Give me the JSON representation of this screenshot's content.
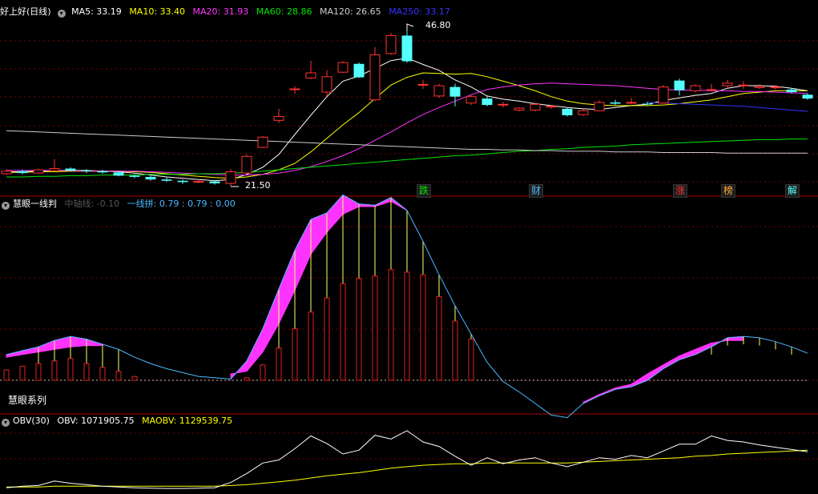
{
  "colors": {
    "up": "#ff3232",
    "down": "#54ffff",
    "ma5": "#ffffff",
    "ma10": "#ffff00",
    "ma20": "#ff33ff",
    "ma60": "#00e600",
    "ma120": "#cccccc",
    "ma250": "#3333ff",
    "grid": "#7a0000",
    "fill": "#ff33ff",
    "line2": "#4db8ff",
    "obv": "#ffffff",
    "maobv": "#ffff00"
  },
  "main_header": {
    "title": "好上好(日线)",
    "ma5": "MA5: 33.19",
    "ma10": "MA10: 33.40",
    "ma20": "MA20: 31.93",
    "ma60": "MA60: 28.86",
    "ma120": "MA120: 26.65",
    "ma250": "MA250: 33.17"
  },
  "sub1_header": {
    "title": "慧眼一线判",
    "item1": "中轴线: -0.10",
    "item2": "一线拼: 0.79 : 0.79 : 0.00"
  },
  "sub1_label": "慧眼系列",
  "sub2_header": {
    "title": "OBV(30)",
    "obv": "OBV: 1071905.75",
    "maobv": "MAOBV: 1129539.75"
  },
  "annotations": {
    "high": "46.80",
    "low": "21.50"
  },
  "tags": [
    {
      "text": "跌",
      "color": "#00e600",
      "idx": 26
    },
    {
      "text": "财",
      "color": "#4db8ff",
      "idx": 33
    },
    {
      "text": "涨",
      "color": "#ff3232",
      "idx": 42
    },
    {
      "text": "榜",
      "color": "#ffaa33",
      "idx": 45
    },
    {
      "text": "解",
      "color": "#54ffff",
      "idx": 49
    }
  ],
  "chart_data": [
    {
      "type": "candlestick",
      "title": "好上好(日线)",
      "ylim": [
        20,
        48
      ],
      "candles": [
        [
          23.5,
          23.9,
          24.2,
          23.3
        ],
        [
          23.9,
          23.6,
          24.1,
          23.4
        ],
        [
          23.6,
          24.1,
          24.3,
          23.5
        ],
        [
          24.0,
          24.3,
          25.8,
          23.9
        ],
        [
          24.3,
          24.0,
          24.5,
          23.8
        ],
        [
          24.0,
          23.9,
          24.2,
          23.6
        ],
        [
          23.9,
          23.7,
          24.1,
          23.5
        ],
        [
          23.7,
          23.2,
          23.9,
          23.1
        ],
        [
          23.2,
          23.0,
          23.4,
          22.8
        ],
        [
          23.0,
          22.6,
          23.2,
          22.4
        ],
        [
          22.6,
          22.4,
          22.9,
          22.2
        ],
        [
          22.4,
          22.2,
          22.6,
          21.9
        ],
        [
          22.2,
          22.3,
          22.6,
          22.0
        ],
        [
          22.3,
          22.0,
          22.5,
          21.8
        ],
        [
          22.0,
          23.8,
          24.2,
          21.5
        ],
        [
          23.6,
          26.2,
          26.5,
          23.5
        ],
        [
          27.6,
          29.2,
          29.4,
          27.5
        ],
        [
          31.8,
          32.4,
          33.6,
          31.4
        ],
        [
          36.7,
          36.7,
          37.1,
          35.9
        ],
        [
          38.4,
          39.2,
          41.1,
          38.2
        ],
        [
          36.2,
          38.6,
          39.6,
          35.6
        ],
        [
          39.3,
          40.8,
          41.0,
          39.2
        ],
        [
          40.6,
          38.5,
          40.8,
          38.4
        ],
        [
          35.0,
          42.0,
          43.2,
          34.8
        ],
        [
          42.2,
          45.0,
          45.4,
          42.0
        ],
        [
          45.0,
          41.0,
          46.8,
          40.8
        ],
        [
          37.4,
          37.4,
          38.1,
          36.7
        ],
        [
          35.6,
          37.2,
          37.5,
          35.3
        ],
        [
          37.0,
          35.5,
          37.5,
          34.0
        ],
        [
          34.5,
          35.5,
          35.8,
          34.2
        ],
        [
          35.2,
          34.2,
          35.6,
          34.0
        ],
        [
          34.3,
          34.3,
          34.7,
          33.8
        ],
        [
          33.4,
          33.7,
          33.9,
          33.2
        ],
        [
          33.4,
          34.3,
          34.5,
          33.2
        ],
        [
          34.0,
          34.0,
          34.2,
          33.6
        ],
        [
          33.6,
          32.6,
          33.8,
          32.4
        ],
        [
          32.7,
          33.3,
          33.5,
          32.5
        ],
        [
          33.3,
          34.6,
          34.9,
          33.2
        ],
        [
          34.6,
          34.4,
          35.0,
          34.2
        ],
        [
          34.6,
          34.6,
          35.3,
          34.3
        ],
        [
          34.4,
          34.3,
          34.7,
          34.2
        ],
        [
          34.5,
          37.0,
          37.3,
          34.4
        ],
        [
          38.0,
          36.5,
          38.3,
          35.7
        ],
        [
          36.4,
          37.2,
          37.4,
          36.2
        ],
        [
          36.6,
          36.6,
          37.5,
          36.3
        ],
        [
          37.2,
          37.6,
          38.1,
          36.9
        ],
        [
          37.3,
          37.3,
          37.9,
          36.7
        ],
        [
          36.9,
          37.1,
          37.4,
          36.7
        ],
        [
          37.0,
          37.0,
          37.3,
          36.6
        ],
        [
          36.6,
          36.2,
          36.8,
          36.0
        ],
        [
          35.8,
          35.2,
          36.0,
          35.0
        ]
      ],
      "series": [
        {
          "name": "MA5",
          "values": [
            23.8,
            23.8,
            23.9,
            24.0,
            24.0,
            24.0,
            23.9,
            23.8,
            23.6,
            23.3,
            23.0,
            22.8,
            22.6,
            22.4,
            22.6,
            23.4,
            24.5,
            26.5,
            29.6,
            32.6,
            35.5,
            37.9,
            38.7,
            39.9,
            41.1,
            41.5,
            40.5,
            39.6,
            38.1,
            37.0,
            35.6,
            35.1,
            34.8,
            34.4,
            34.1,
            33.8,
            33.6,
            33.5,
            33.8,
            34.1,
            34.3,
            34.9,
            35.3,
            35.7,
            36.0,
            36.8,
            37.2,
            37.2,
            37.1,
            36.8,
            36.4
          ]
        },
        {
          "name": "MA10",
          "values": [
            23.7,
            23.7,
            23.8,
            23.8,
            23.9,
            23.9,
            23.9,
            23.9,
            23.8,
            23.7,
            23.5,
            23.3,
            23.1,
            22.9,
            22.8,
            23.0,
            23.4,
            24.1,
            25.1,
            26.9,
            29.0,
            31.1,
            33.0,
            35.2,
            37.3,
            38.5,
            39.2,
            39.1,
            39.0,
            39.1,
            38.6,
            37.9,
            37.2,
            36.4,
            35.5,
            34.8,
            34.4,
            34.2,
            34.1,
            34.1,
            34.1,
            34.2,
            34.4,
            34.7,
            35.0,
            35.5,
            36.0,
            36.2,
            36.4,
            36.4,
            36.4
          ]
        },
        {
          "name": "MA20",
          "values": [
            24.0,
            24.0,
            24.0,
            24.0,
            24.0,
            23.9,
            23.9,
            23.9,
            23.9,
            23.8,
            23.7,
            23.6,
            23.5,
            23.4,
            23.3,
            23.3,
            23.4,
            23.6,
            24.0,
            24.6,
            25.4,
            26.3,
            27.4,
            28.7,
            30.0,
            31.4,
            32.7,
            33.8,
            34.8,
            35.8,
            36.6,
            37.0,
            37.3,
            37.5,
            37.6,
            37.5,
            37.4,
            37.3,
            37.2,
            37.0,
            36.8,
            36.6,
            36.5,
            36.5,
            36.4,
            36.4,
            36.3,
            36.3,
            36.2,
            36.1,
            36.0
          ]
        },
        {
          "name": "MA60",
          "values": [
            23.0,
            23.0,
            23.1,
            23.1,
            23.2,
            23.2,
            23.3,
            23.3,
            23.3,
            23.4,
            23.4,
            23.4,
            23.5,
            23.5,
            23.6,
            23.7,
            23.9,
            24.1,
            24.3,
            24.5,
            24.7,
            24.9,
            25.1,
            25.3,
            25.5,
            25.7,
            25.9,
            26.1,
            26.3,
            26.4,
            26.6,
            26.8,
            27.0,
            27.1,
            27.3,
            27.4,
            27.6,
            27.7,
            27.8,
            28.0,
            28.1,
            28.2,
            28.3,
            28.4,
            28.5,
            28.6,
            28.7,
            28.8,
            28.8,
            28.9,
            28.9
          ]
        },
        {
          "name": "MA120",
          "values": [
            30.2,
            30.1,
            30.0,
            29.9,
            29.8,
            29.7,
            29.6,
            29.5,
            29.4,
            29.3,
            29.2,
            29.1,
            29.0,
            28.9,
            28.8,
            28.7,
            28.6,
            28.5,
            28.4,
            28.3,
            28.2,
            28.1,
            28.0,
            27.9,
            27.8,
            27.7,
            27.6,
            27.5,
            27.4,
            27.3,
            27.3,
            27.2,
            27.2,
            27.1,
            27.1,
            27.0,
            27.0,
            27.0,
            26.9,
            26.9,
            26.9,
            26.8,
            26.8,
            26.8,
            26.8,
            26.7,
            26.7,
            26.7,
            26.7,
            26.7,
            26.7
          ]
        },
        {
          "name": "MA250",
          "values": [
            null,
            null,
            null,
            null,
            null,
            null,
            null,
            null,
            null,
            null,
            null,
            null,
            null,
            null,
            null,
            null,
            null,
            null,
            null,
            null,
            null,
            null,
            null,
            null,
            null,
            null,
            null,
            null,
            null,
            null,
            null,
            null,
            null,
            null,
            null,
            null,
            null,
            null,
            null,
            null,
            34.6,
            34.5,
            34.4,
            34.3,
            34.2,
            34.1,
            34.0,
            33.8,
            33.6,
            33.4,
            33.2
          ]
        }
      ]
    },
    {
      "type": "line",
      "title": "慧眼一线判",
      "ylim": [
        -3,
        15
      ],
      "series": [
        {
          "name": "中轴线",
          "values": [
            2.0,
            2.3,
            2.6,
            3.1,
            3.4,
            3.2,
            2.8,
            2.4,
            1.8,
            1.3,
            0.9,
            0.6,
            0.3,
            0.2,
            0.1,
            1.5,
            4.0,
            7.1,
            10.1,
            12.5,
            13.0,
            14.4,
            13.7,
            13.6,
            14.2,
            13.2,
            10.8,
            8.2,
            5.8,
            3.6,
            1.4,
            -0.1,
            -0.9,
            -1.8,
            -2.7,
            -2.9,
            -1.8,
            -1.2,
            -0.7,
            -0.5,
            0.0,
            0.9,
            1.6,
            2.0,
            2.6,
            3.3,
            3.4,
            3.3,
            3.0,
            2.6,
            2.1
          ]
        },
        {
          "name": "一线拼",
          "values": [
            1.8,
            2.0,
            2.2,
            2.4,
            2.6,
            2.7,
            2.7,
            2.6,
            2.4,
            2.1,
            1.8,
            1.5,
            1.2,
            0.9,
            0.5,
            0.7,
            2.2,
            4.4,
            7.0,
            9.8,
            11.5,
            12.9,
            13.5,
            13.5,
            13.9,
            13.2,
            null,
            null,
            null,
            null,
            null,
            null,
            null,
            null,
            null,
            null,
            -1.7,
            -1.1,
            -0.6,
            -0.3,
            0.5,
            1.2,
            1.9,
            2.4,
            2.9,
            3.1,
            3.1,
            null,
            null,
            null,
            null
          ]
        },
        {
          "name": "bars",
          "values": [
            0.8,
            1.1,
            1.3,
            1.5,
            1.7,
            1.3,
            1.0,
            0.7,
            0.3,
            null,
            null,
            null,
            null,
            null,
            null,
            0.2,
            1.2,
            2.5,
            4.0,
            5.3,
            6.4,
            7.5,
            7.9,
            8.1,
            8.6,
            8.4,
            8.2,
            6.5,
            4.6,
            3.2,
            null,
            null,
            null,
            null,
            null,
            null,
            null,
            null,
            null,
            null,
            null,
            null,
            null,
            null,
            null,
            null,
            null,
            null,
            null,
            null,
            null
          ]
        }
      ]
    },
    {
      "type": "line",
      "title": "OBV(30)",
      "ylim": [
        0,
        10
      ],
      "series": [
        {
          "name": "OBV",
          "values": [
            0.3,
            0.5,
            0.6,
            1.2,
            0.9,
            0.7,
            0.5,
            0.4,
            0.3,
            0.25,
            0.2,
            0.2,
            0.25,
            0.3,
            1.0,
            2.2,
            3.6,
            4.0,
            5.5,
            7.2,
            6.2,
            4.8,
            5.3,
            7.3,
            6.8,
            7.9,
            6.4,
            5.8,
            4.5,
            3.3,
            4.3,
            3.5,
            4.0,
            4.3,
            3.6,
            3.1,
            3.7,
            4.3,
            4.1,
            4.6,
            4.3,
            5.2,
            6.1,
            6.1,
            7.2,
            6.6,
            6.4,
            6.0,
            5.7,
            5.4,
            5.1
          ]
        },
        {
          "name": "MAOBV",
          "values": [
            0.4,
            0.4,
            0.4,
            0.5,
            0.5,
            0.5,
            0.5,
            0.5,
            0.5,
            0.5,
            0.5,
            0.5,
            0.5,
            0.5,
            0.6,
            0.7,
            0.9,
            1.1,
            1.3,
            1.6,
            1.9,
            2.1,
            2.3,
            2.6,
            2.9,
            3.1,
            3.3,
            3.4,
            3.5,
            3.5,
            3.6,
            3.6,
            3.6,
            3.6,
            3.6,
            3.6,
            3.7,
            3.8,
            3.9,
            4.0,
            4.1,
            4.2,
            4.3,
            4.5,
            4.6,
            4.8,
            4.9,
            5.0,
            5.1,
            5.2,
            5.3
          ]
        }
      ]
    }
  ]
}
